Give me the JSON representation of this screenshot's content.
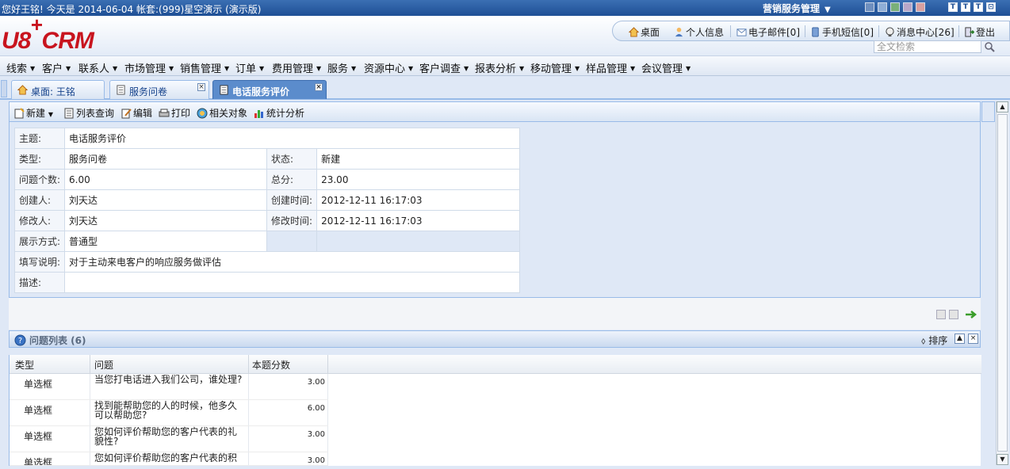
{
  "topbar": {
    "greeting": "您好王铭!   今天是  2014-06-04 帐套:(999)星空演示 (演示版)",
    "app_name": "营销服务管理",
    "window_buttons": [
      "T",
      "T",
      "T",
      "⊡"
    ]
  },
  "header": {
    "logo_prefix": "U8",
    "logo_plus": "+",
    "logo_suffix": "CRM",
    "quick_links": [
      "桌面",
      "个人信息",
      "电子邮件[0]",
      "手机短信[0]",
      "消息中心[26]",
      "登出"
    ],
    "search_placeholder": "全文检索"
  },
  "menu": {
    "items": [
      "线索",
      "客户",
      "联系人",
      "市场管理",
      "销售管理",
      "订单",
      "费用管理",
      "服务",
      "资源中心",
      "客户调查",
      "报表分析",
      "移动管理",
      "样品管理",
      "会议管理"
    ]
  },
  "tabs": [
    {
      "label": "桌面: 王铭",
      "closable": false,
      "active": false
    },
    {
      "label": "服务问卷",
      "closable": true,
      "active": false
    },
    {
      "label": "电话服务评价",
      "closable": true,
      "active": true
    }
  ],
  "toolbar": {
    "items": [
      "新建",
      "列表查询",
      "编辑",
      "打印",
      "相关对象",
      "统计分析"
    ]
  },
  "form": {
    "subject_label": "主题:",
    "subject": "电话服务评价",
    "type_label": "类型:",
    "type": "服务问卷",
    "status_label": "状态:",
    "status": "新建",
    "qcount_label": "问题个数:",
    "qcount": "6.00",
    "total_label": "总分:",
    "total": "23.00",
    "creator_label": "创建人:",
    "creator": "刘天达",
    "ctime_label": "创建时间:",
    "ctime": "2012-12-11 16:17:03",
    "modifier_label": "修改人:",
    "modifier": "刘天达",
    "mtime_label": "修改时间:",
    "mtime": "2012-12-11 16:17:03",
    "display_label": "展示方式:",
    "display": "普通型",
    "fill_label": "填写说明:",
    "fill": "对于主动来电客户的响应服务做评估",
    "desc_label": "描述:",
    "desc": ""
  },
  "questions": {
    "title": "问题列表 (6)",
    "sort_label": "排序",
    "columns": [
      "类型",
      "问题",
      "本题分数"
    ],
    "rows": [
      {
        "type": "单选框",
        "question": "当您打电话进入我们公司，谁处理?",
        "score": "3.00"
      },
      {
        "type": "单选框",
        "question": "找到能帮助您的人的时候，他多久可以帮助您?",
        "score": "6.00"
      },
      {
        "type": "单选框",
        "question": "您如何评价帮助您的客户代表的礼貌性?",
        "score": "3.00"
      },
      {
        "type": "单选框",
        "question": "您如何评价帮助您的客户代表的积",
        "score": "3.00"
      }
    ]
  },
  "colors": {
    "brand_red": "#c8141e",
    "topbar_blue": "#1e4f95",
    "active_tab": "#5b8ccc"
  }
}
